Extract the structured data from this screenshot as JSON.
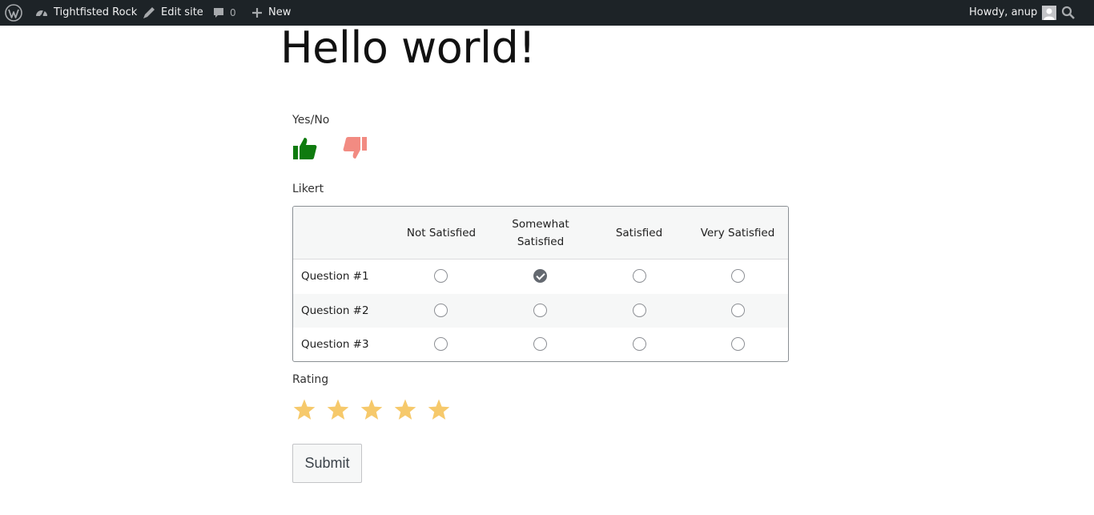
{
  "adminbar": {
    "site_name": "Tightfisted Rock",
    "edit_site": "Edit site",
    "comments_count": "0",
    "new_label": "New",
    "howdy": "Howdy, anup"
  },
  "page": {
    "title": "Hello world!"
  },
  "form": {
    "yesno_label": "Yes/No",
    "likert_label": "Likert",
    "likert_columns": [
      "Not Satisfied",
      "Somewhat Satisfied",
      "Satisfied",
      "Very Satisfied"
    ],
    "likert_rows": [
      {
        "question": "Question #1",
        "selected": 1
      },
      {
        "question": "Question #2",
        "selected": null
      },
      {
        "question": "Question #3",
        "selected": null
      }
    ],
    "rating_label": "Rating",
    "rating_stars": 5,
    "submit_label": "Submit"
  },
  "colors": {
    "adminbar_bg": "#1d2327",
    "thumb_up": "#0f7b0f",
    "thumb_down": "#f28b82",
    "star": "#f6c96b"
  },
  "icons": [
    "wordpress-icon",
    "dashboard-icon",
    "edit-site-icon",
    "comment-icon",
    "plus-icon",
    "avatar-icon",
    "search-icon",
    "thumbs-up-icon",
    "thumbs-down-icon",
    "star-icon"
  ]
}
